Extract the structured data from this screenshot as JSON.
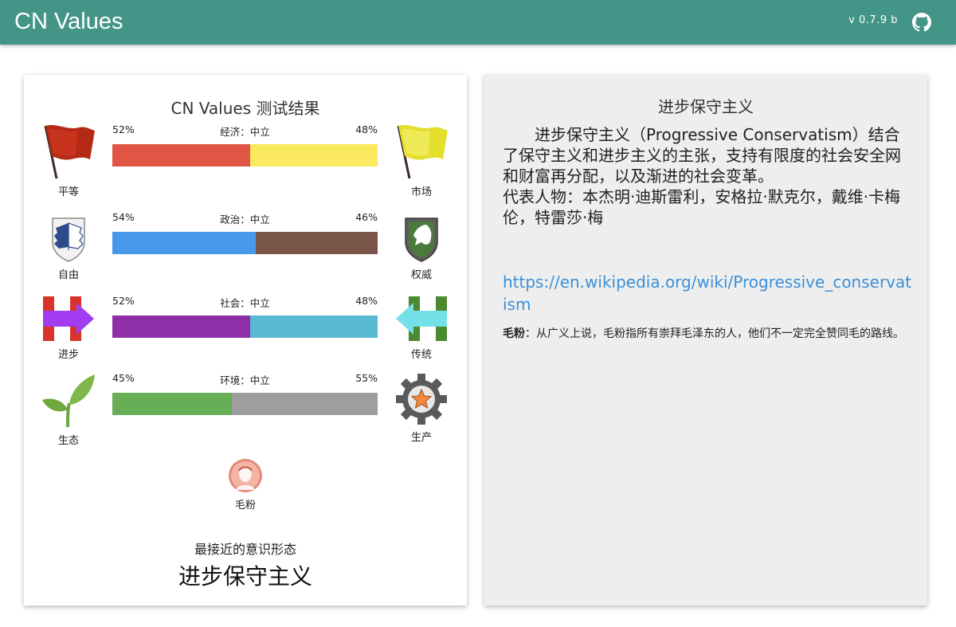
{
  "header": {
    "title": "CN Values",
    "version": "v 0.7.9 b",
    "github_icon": "github-icon"
  },
  "results": {
    "title": "CN Values 测试结果",
    "axes": [
      {
        "key": "econ",
        "label": "经济：中立",
        "left": {
          "name": "平等",
          "percent_text": "52%",
          "value": 52,
          "color": "#e05544",
          "icon": "red-flag-icon"
        },
        "right": {
          "name": "市场",
          "percent_text": "48%",
          "value": 48,
          "color": "#fbe95f",
          "icon": "yellow-flag-icon"
        }
      },
      {
        "key": "govt",
        "label": "政治：中立",
        "left": {
          "name": "自由",
          "percent_text": "54%",
          "value": 54,
          "color": "#4a98ea",
          "icon": "wings-of-freedom-icon"
        },
        "right": {
          "name": "权威",
          "percent_text": "46%",
          "value": 46,
          "color": "#7a5549",
          "icon": "horse-shield-icon"
        }
      },
      {
        "key": "scty",
        "label": "社会：中立",
        "left": {
          "name": "进步",
          "percent_text": "52%",
          "value": 52,
          "color": "#8e2fa7",
          "icon": "right-arrow-h-icon"
        },
        "right": {
          "name": "传统",
          "percent_text": "48%",
          "value": 48,
          "color": "#57b9d2",
          "icon": "left-arrow-h-icon"
        }
      },
      {
        "key": "envo",
        "label": "环境：中立",
        "left": {
          "name": "生态",
          "percent_text": "45%",
          "value": 45,
          "color": "#67ae56",
          "icon": "sprout-icon"
        },
        "right": {
          "name": "生产",
          "percent_text": "55%",
          "value": 55,
          "color": "#9e9e9e",
          "icon": "gear-star-icon"
        }
      }
    ],
    "badge": {
      "name": "毛粉",
      "icon": "mao-portrait-icon"
    },
    "closest_label": "最接近的意识形态",
    "closest_name": "进步保守主义"
  },
  "description": {
    "title": "进步保守主义",
    "paragraph": "进步保守主义（Progressive Conservatism）结合了保守主义和进步主义的主张，支持有限度的社会安全网和财富再分配，以及渐进的社会变革。",
    "representatives": "代表人物：本杰明·迪斯雷利，安格拉·默克尔，戴维·卡梅伦，特雷莎·梅",
    "link": "https://en.wikipedia.org/wiki/Progressive_conservatism",
    "note_term": "毛粉",
    "note_text": "：从广义上说，毛粉指所有崇拜毛泽东的人，他们不一定完全赞同毛的路线。"
  }
}
